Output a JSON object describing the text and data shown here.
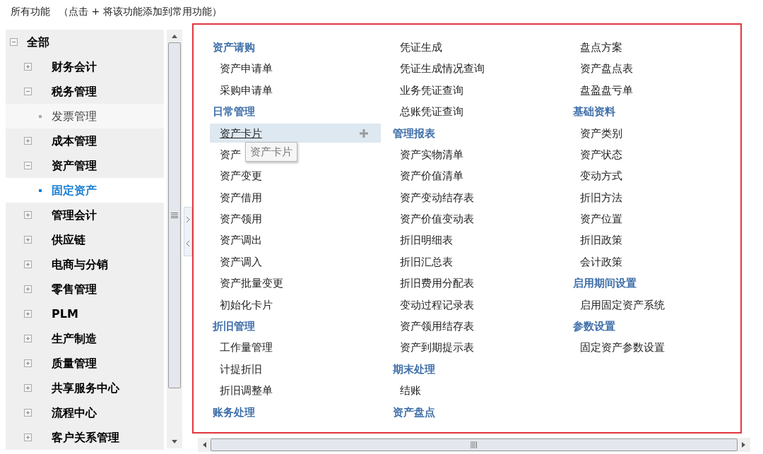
{
  "header": {
    "title": "所有功能",
    "hint": "（点击 + 将该功能添加到常用功能）"
  },
  "tree": {
    "label": "全部",
    "expanded": true,
    "children": [
      {
        "label": "财务会计",
        "expanded": false
      },
      {
        "label": "税务管理",
        "expanded": true,
        "children": [
          {
            "label": "发票管理",
            "selected": false
          }
        ]
      },
      {
        "label": "成本管理",
        "expanded": false
      },
      {
        "label": "资产管理",
        "expanded": true,
        "children": [
          {
            "label": "固定资产",
            "selected": true
          }
        ]
      },
      {
        "label": "管理会计",
        "expanded": false
      },
      {
        "label": "供应链",
        "expanded": false
      },
      {
        "label": "电商与分销",
        "expanded": false
      },
      {
        "label": "零售管理",
        "expanded": false
      },
      {
        "label": "PLM",
        "expanded": false
      },
      {
        "label": "生产制造",
        "expanded": false
      },
      {
        "label": "质量管理",
        "expanded": false
      },
      {
        "label": "共享服务中心",
        "expanded": false
      },
      {
        "label": "流程中心",
        "expanded": false
      },
      {
        "label": "客户关系管理",
        "expanded": false
      }
    ]
  },
  "columns": [
    [
      {
        "kind": "header",
        "text": "资产请购"
      },
      {
        "kind": "item",
        "text": "资产申请单",
        "hovered": false
      },
      {
        "kind": "item",
        "text": "采购申请单",
        "hovered": false
      },
      {
        "kind": "header",
        "text": "日常管理"
      },
      {
        "kind": "item",
        "text": "资产卡片",
        "hovered": true,
        "tooltip": "资产卡片"
      },
      {
        "kind": "item",
        "text": "资产",
        "hovered": false
      },
      {
        "kind": "item",
        "text": "资产变更",
        "hovered": false
      },
      {
        "kind": "item",
        "text": "资产借用",
        "hovered": false
      },
      {
        "kind": "item",
        "text": "资产领用",
        "hovered": false
      },
      {
        "kind": "item",
        "text": "资产调出",
        "hovered": false
      },
      {
        "kind": "item",
        "text": "资产调入",
        "hovered": false
      },
      {
        "kind": "item",
        "text": "资产批量变更",
        "hovered": false
      },
      {
        "kind": "item",
        "text": "初始化卡片",
        "hovered": false
      },
      {
        "kind": "header",
        "text": "折旧管理"
      },
      {
        "kind": "item",
        "text": "工作量管理",
        "hovered": false
      },
      {
        "kind": "item",
        "text": "计提折旧",
        "hovered": false
      },
      {
        "kind": "item",
        "text": "折旧调整单",
        "hovered": false
      },
      {
        "kind": "header",
        "text": "账务处理"
      }
    ],
    [
      {
        "kind": "item",
        "text": "凭证生成",
        "hovered": false
      },
      {
        "kind": "item",
        "text": "凭证生成情况查询",
        "hovered": false
      },
      {
        "kind": "item",
        "text": "业务凭证查询",
        "hovered": false
      },
      {
        "kind": "item",
        "text": "总账凭证查询",
        "hovered": false
      },
      {
        "kind": "header",
        "text": "管理报表"
      },
      {
        "kind": "item",
        "text": "资产实物清单",
        "hovered": false
      },
      {
        "kind": "item",
        "text": "资产价值清单",
        "hovered": false
      },
      {
        "kind": "item",
        "text": "资产变动结存表",
        "hovered": false
      },
      {
        "kind": "item",
        "text": "资产价值变动表",
        "hovered": false
      },
      {
        "kind": "item",
        "text": "折旧明细表",
        "hovered": false
      },
      {
        "kind": "item",
        "text": "折旧汇总表",
        "hovered": false
      },
      {
        "kind": "item",
        "text": "折旧费用分配表",
        "hovered": false
      },
      {
        "kind": "item",
        "text": "变动过程记录表",
        "hovered": false
      },
      {
        "kind": "item",
        "text": "资产领用结存表",
        "hovered": false
      },
      {
        "kind": "item",
        "text": "资产到期提示表",
        "hovered": false
      },
      {
        "kind": "header",
        "text": "期末处理"
      },
      {
        "kind": "item",
        "text": "结账",
        "hovered": false
      },
      {
        "kind": "header",
        "text": "资产盘点"
      }
    ],
    [
      {
        "kind": "item",
        "text": "盘点方案",
        "hovered": false
      },
      {
        "kind": "item",
        "text": "资产盘点表",
        "hovered": false
      },
      {
        "kind": "item",
        "text": "盘盈盘亏单",
        "hovered": false
      },
      {
        "kind": "header",
        "text": "基础资料"
      },
      {
        "kind": "item",
        "text": "资产类别",
        "hovered": false
      },
      {
        "kind": "item",
        "text": "资产状态",
        "hovered": false
      },
      {
        "kind": "item",
        "text": "变动方式",
        "hovered": false
      },
      {
        "kind": "item",
        "text": "折旧方法",
        "hovered": false
      },
      {
        "kind": "item",
        "text": "资产位置",
        "hovered": false
      },
      {
        "kind": "item",
        "text": "折旧政策",
        "hovered": false
      },
      {
        "kind": "item",
        "text": "会计政策",
        "hovered": false
      },
      {
        "kind": "header",
        "text": "启用期间设置"
      },
      {
        "kind": "item",
        "text": "启用固定资产系统",
        "hovered": false
      },
      {
        "kind": "header",
        "text": "参数设置"
      },
      {
        "kind": "item",
        "text": "固定资产参数设置",
        "hovered": false
      }
    ]
  ]
}
